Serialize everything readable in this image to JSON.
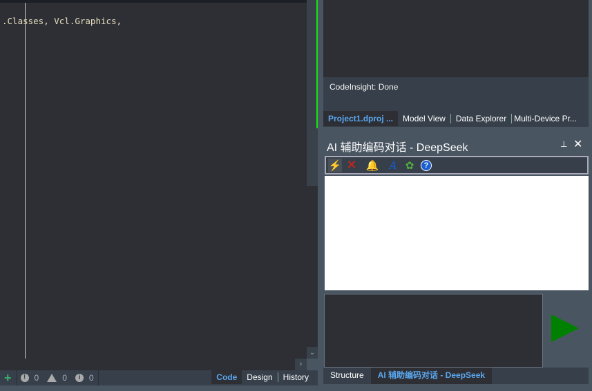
{
  "editor": {
    "code_line": ".Classes, Vcl.Graphics,"
  },
  "status": {
    "add_icon": "plus-icon",
    "errors": "0",
    "warnings": "0",
    "hints": "0"
  },
  "editor_tabs": [
    {
      "label": "Code"
    },
    {
      "label": "Design"
    },
    {
      "label": "History"
    }
  ],
  "right_panel": {
    "message": "CodeInsight: Done",
    "tabs": [
      {
        "label": "Project1.dproj ..."
      },
      {
        "label": "Model View"
      },
      {
        "label": "Data Explorer"
      },
      {
        "label": "Multi-Device Pr..."
      }
    ],
    "ai_title": "AI 辅助编码对话 - DeepSeek",
    "pin": "⊥",
    "close": "✕",
    "toolbar_icons": [
      "lightning-icon",
      "delete-icon",
      "bell-icon",
      "font-icon",
      "plugin-icon",
      "help-icon"
    ],
    "input_value": "",
    "bottom_tabs": [
      {
        "label": "Structure"
      },
      {
        "label": "AI 辅助编码对话 - DeepSeek"
      }
    ]
  },
  "colors": {
    "accent": "#5aa7f0",
    "send": "#008000",
    "green_bar": "#14e614"
  }
}
